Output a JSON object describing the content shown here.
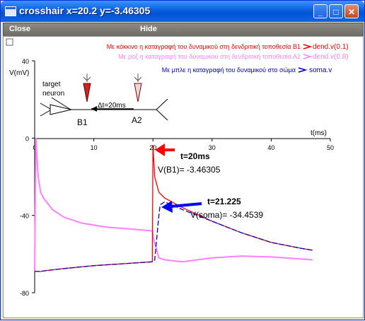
{
  "window": {
    "title": "crosshair x=20.2 y=-3.46305",
    "icon": "window-icon",
    "controls": [
      "minimize-icon",
      "maximize-icon",
      "close-icon"
    ]
  },
  "menu": {
    "close_label": "Close",
    "hide_label": "Hide"
  },
  "legend": {
    "items": [
      {
        "text": "Με κόκκινο η καταγραφή του δυναμικού στη δενδριτική τοποθεσία B1",
        "label": "dend.v(0.1)",
        "color": "#FF0000"
      },
      {
        "text": "Με ροζ η καταγραφή του δυναμικού στη δενδριτική τοποθεσία Α2",
        "label": "dend.v(0.8)",
        "color": "#FF80FF"
      },
      {
        "text": "Με μπλε η καταγραφή του δυναμικού στο σώμα",
        "label": "soma.v",
        "color": "#0000CC"
      }
    ]
  },
  "axes": {
    "y_label": "V(mV)",
    "x_label": "t(ms)",
    "y_ticks": [
      "40",
      "0",
      "-40",
      "-80"
    ],
    "x_ticks": [
      "0",
      "10",
      "20",
      "30",
      "40",
      "50"
    ]
  },
  "schematic": {
    "target_label_1": "target",
    "target_label_2": "neuron",
    "delay_label": "Δt=20ms",
    "site_b1": "B1",
    "site_a2": "A2"
  },
  "annotations": {
    "red_time": "t=20ms",
    "red_value": "V(B1)= -3.46305",
    "blue_time": "t=21.225",
    "blue_value": "V(soma)= -34.4539"
  },
  "chart_data": {
    "type": "line",
    "xlabel": "t(ms)",
    "ylabel": "V(mV)",
    "xlim": [
      0,
      50
    ],
    "ylim": [
      -80,
      40
    ],
    "series": [
      {
        "name": "dend.v(0.1)",
        "color": "#FF0000",
        "x": [
          0,
          0.3,
          1,
          2,
          5,
          10,
          15,
          19.9,
          20,
          20.3,
          21,
          22,
          25,
          30,
          35,
          40,
          45,
          47
        ],
        "y": [
          -69,
          -69,
          -69,
          -68.5,
          -67.5,
          -66,
          -65,
          -64,
          -3.5,
          -20,
          -28,
          -31,
          -36,
          -43,
          -49,
          -54,
          -57,
          -58
        ]
      },
      {
        "name": "dend.v(0.8)",
        "color": "#FF80FF",
        "x": [
          0,
          0.2,
          0.6,
          1,
          1.5,
          2,
          3,
          5,
          8,
          12,
          16,
          19.9,
          20.1,
          21,
          22,
          25,
          30,
          35,
          40,
          45,
          47
        ],
        "y": [
          -69,
          0,
          -20,
          -28,
          -31,
          -33,
          -37,
          -41,
          -44,
          -46,
          -47,
          -48,
          -52,
          -62,
          -63,
          -64,
          -62,
          -61,
          -61.5,
          -62.5,
          -63
        ]
      },
      {
        "name": "soma.v",
        "color": "#0000CC",
        "x": [
          0,
          0.3,
          1,
          2,
          5,
          10,
          15,
          19.9,
          20.3,
          21,
          21.225,
          22,
          25,
          30,
          35,
          40,
          45,
          47
        ],
        "y": [
          -69,
          -69,
          -69,
          -68.5,
          -67.5,
          -66,
          -65,
          -64,
          -63,
          -40,
          -34.5,
          -33,
          -37,
          -43,
          -49,
          -54,
          -57,
          -58
        ]
      }
    ]
  }
}
